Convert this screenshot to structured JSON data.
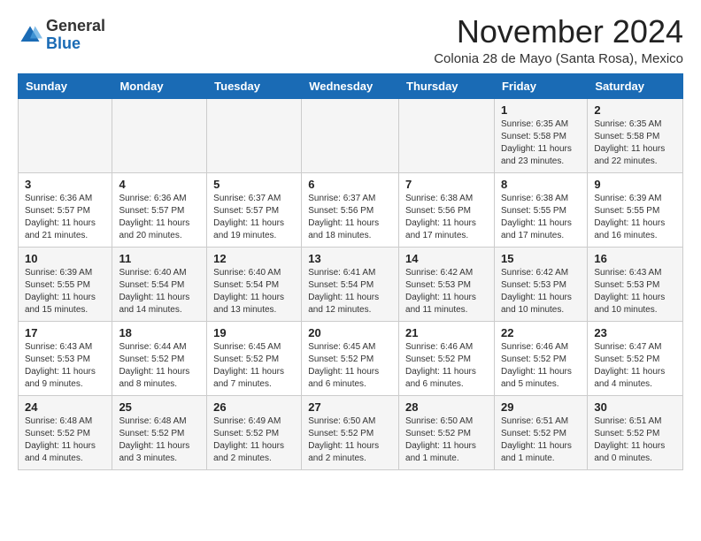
{
  "header": {
    "logo_general": "General",
    "logo_blue": "Blue",
    "month_title": "November 2024",
    "subtitle": "Colonia 28 de Mayo (Santa Rosa), Mexico"
  },
  "calendar": {
    "days_of_week": [
      "Sunday",
      "Monday",
      "Tuesday",
      "Wednesday",
      "Thursday",
      "Friday",
      "Saturday"
    ],
    "weeks": [
      [
        {
          "day": "",
          "info": ""
        },
        {
          "day": "",
          "info": ""
        },
        {
          "day": "",
          "info": ""
        },
        {
          "day": "",
          "info": ""
        },
        {
          "day": "",
          "info": ""
        },
        {
          "day": "1",
          "info": "Sunrise: 6:35 AM\nSunset: 5:58 PM\nDaylight: 11 hours and 23 minutes."
        },
        {
          "day": "2",
          "info": "Sunrise: 6:35 AM\nSunset: 5:58 PM\nDaylight: 11 hours and 22 minutes."
        }
      ],
      [
        {
          "day": "3",
          "info": "Sunrise: 6:36 AM\nSunset: 5:57 PM\nDaylight: 11 hours and 21 minutes."
        },
        {
          "day": "4",
          "info": "Sunrise: 6:36 AM\nSunset: 5:57 PM\nDaylight: 11 hours and 20 minutes."
        },
        {
          "day": "5",
          "info": "Sunrise: 6:37 AM\nSunset: 5:57 PM\nDaylight: 11 hours and 19 minutes."
        },
        {
          "day": "6",
          "info": "Sunrise: 6:37 AM\nSunset: 5:56 PM\nDaylight: 11 hours and 18 minutes."
        },
        {
          "day": "7",
          "info": "Sunrise: 6:38 AM\nSunset: 5:56 PM\nDaylight: 11 hours and 17 minutes."
        },
        {
          "day": "8",
          "info": "Sunrise: 6:38 AM\nSunset: 5:55 PM\nDaylight: 11 hours and 17 minutes."
        },
        {
          "day": "9",
          "info": "Sunrise: 6:39 AM\nSunset: 5:55 PM\nDaylight: 11 hours and 16 minutes."
        }
      ],
      [
        {
          "day": "10",
          "info": "Sunrise: 6:39 AM\nSunset: 5:55 PM\nDaylight: 11 hours and 15 minutes."
        },
        {
          "day": "11",
          "info": "Sunrise: 6:40 AM\nSunset: 5:54 PM\nDaylight: 11 hours and 14 minutes."
        },
        {
          "day": "12",
          "info": "Sunrise: 6:40 AM\nSunset: 5:54 PM\nDaylight: 11 hours and 13 minutes."
        },
        {
          "day": "13",
          "info": "Sunrise: 6:41 AM\nSunset: 5:54 PM\nDaylight: 11 hours and 12 minutes."
        },
        {
          "day": "14",
          "info": "Sunrise: 6:42 AM\nSunset: 5:53 PM\nDaylight: 11 hours and 11 minutes."
        },
        {
          "day": "15",
          "info": "Sunrise: 6:42 AM\nSunset: 5:53 PM\nDaylight: 11 hours and 10 minutes."
        },
        {
          "day": "16",
          "info": "Sunrise: 6:43 AM\nSunset: 5:53 PM\nDaylight: 11 hours and 10 minutes."
        }
      ],
      [
        {
          "day": "17",
          "info": "Sunrise: 6:43 AM\nSunset: 5:53 PM\nDaylight: 11 hours and 9 minutes."
        },
        {
          "day": "18",
          "info": "Sunrise: 6:44 AM\nSunset: 5:52 PM\nDaylight: 11 hours and 8 minutes."
        },
        {
          "day": "19",
          "info": "Sunrise: 6:45 AM\nSunset: 5:52 PM\nDaylight: 11 hours and 7 minutes."
        },
        {
          "day": "20",
          "info": "Sunrise: 6:45 AM\nSunset: 5:52 PM\nDaylight: 11 hours and 6 minutes."
        },
        {
          "day": "21",
          "info": "Sunrise: 6:46 AM\nSunset: 5:52 PM\nDaylight: 11 hours and 6 minutes."
        },
        {
          "day": "22",
          "info": "Sunrise: 6:46 AM\nSunset: 5:52 PM\nDaylight: 11 hours and 5 minutes."
        },
        {
          "day": "23",
          "info": "Sunrise: 6:47 AM\nSunset: 5:52 PM\nDaylight: 11 hours and 4 minutes."
        }
      ],
      [
        {
          "day": "24",
          "info": "Sunrise: 6:48 AM\nSunset: 5:52 PM\nDaylight: 11 hours and 4 minutes."
        },
        {
          "day": "25",
          "info": "Sunrise: 6:48 AM\nSunset: 5:52 PM\nDaylight: 11 hours and 3 minutes."
        },
        {
          "day": "26",
          "info": "Sunrise: 6:49 AM\nSunset: 5:52 PM\nDaylight: 11 hours and 2 minutes."
        },
        {
          "day": "27",
          "info": "Sunrise: 6:50 AM\nSunset: 5:52 PM\nDaylight: 11 hours and 2 minutes."
        },
        {
          "day": "28",
          "info": "Sunrise: 6:50 AM\nSunset: 5:52 PM\nDaylight: 11 hours and 1 minute."
        },
        {
          "day": "29",
          "info": "Sunrise: 6:51 AM\nSunset: 5:52 PM\nDaylight: 11 hours and 1 minute."
        },
        {
          "day": "30",
          "info": "Sunrise: 6:51 AM\nSunset: 5:52 PM\nDaylight: 11 hours and 0 minutes."
        }
      ]
    ]
  }
}
